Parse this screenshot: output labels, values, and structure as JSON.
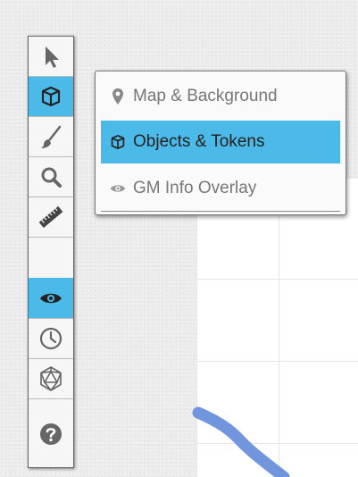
{
  "toolbar": {
    "tools": [
      {
        "id": "select",
        "icon": "pointer-arrow-icon",
        "active": false
      },
      {
        "id": "layers",
        "icon": "cube-icon",
        "active": true
      },
      {
        "id": "draw",
        "icon": "paintbrush-icon",
        "active": false
      },
      {
        "id": "zoom",
        "icon": "magnifier-icon",
        "active": false
      },
      {
        "id": "measure",
        "icon": "ruler-icon",
        "active": false
      },
      {
        "id": "fog",
        "icon": "eye-icon",
        "active": true
      },
      {
        "id": "turn-tracker",
        "icon": "clock-icon",
        "active": false
      },
      {
        "id": "dice",
        "icon": "d20-dice-icon",
        "active": false
      },
      {
        "id": "help",
        "icon": "help-circle-icon",
        "active": false
      }
    ]
  },
  "layer_menu": {
    "items": [
      {
        "label": "Map & Background",
        "icon": "map-pin-icon",
        "active": false
      },
      {
        "label": "Objects & Tokens",
        "icon": "cube-icon",
        "active": true
      },
      {
        "label": "GM Info Overlay",
        "icon": "eye-icon",
        "active": false
      }
    ]
  },
  "colors": {
    "accent": "#4cbae8",
    "drawing_stroke": "#6a90db"
  }
}
